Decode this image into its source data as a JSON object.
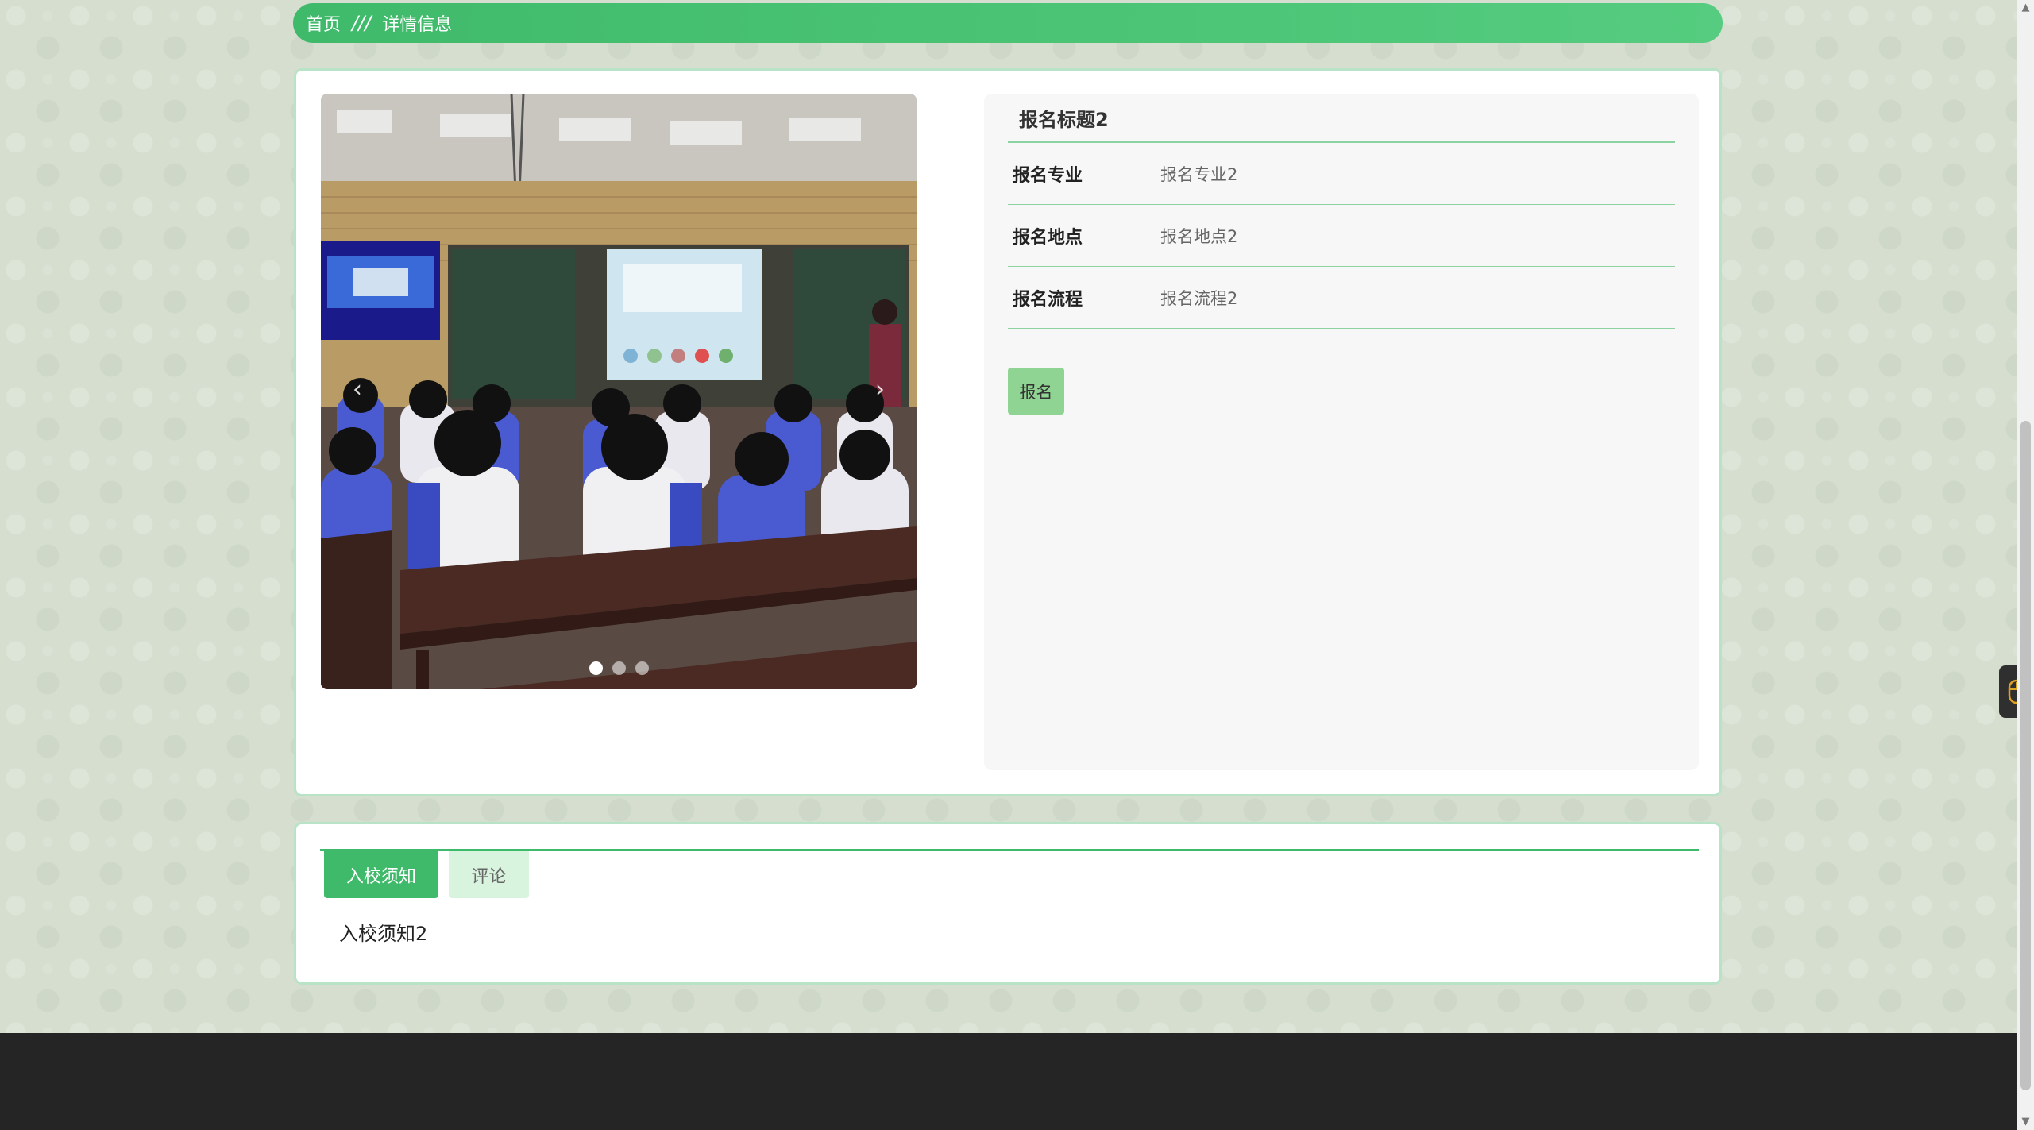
{
  "breadcrumb": {
    "home": "首页",
    "separator": "///",
    "current": "详情信息"
  },
  "detail": {
    "title": "报名标题2",
    "rows": [
      {
        "label": "报名专业",
        "value": "报名专业2"
      },
      {
        "label": "报名地点",
        "value": "报名地点2"
      },
      {
        "label": "报名流程",
        "value": "报名流程2"
      }
    ],
    "button_label": "报名"
  },
  "carousel": {
    "image_icon": "classroom-photo",
    "slide_count": 3,
    "active_index": 0,
    "prev_arrow": "‹",
    "next_arrow": "›"
  },
  "tabs": {
    "items": [
      {
        "label": "入校须知",
        "active": true
      },
      {
        "label": "评论",
        "active": false
      }
    ],
    "content": "入校须知2"
  },
  "side_widget": {
    "icon": "mouse-icon"
  },
  "colors": {
    "accent": "#3fba6a",
    "border": "#b8e3c6",
    "button": "#90d493",
    "footer": "#252525"
  }
}
